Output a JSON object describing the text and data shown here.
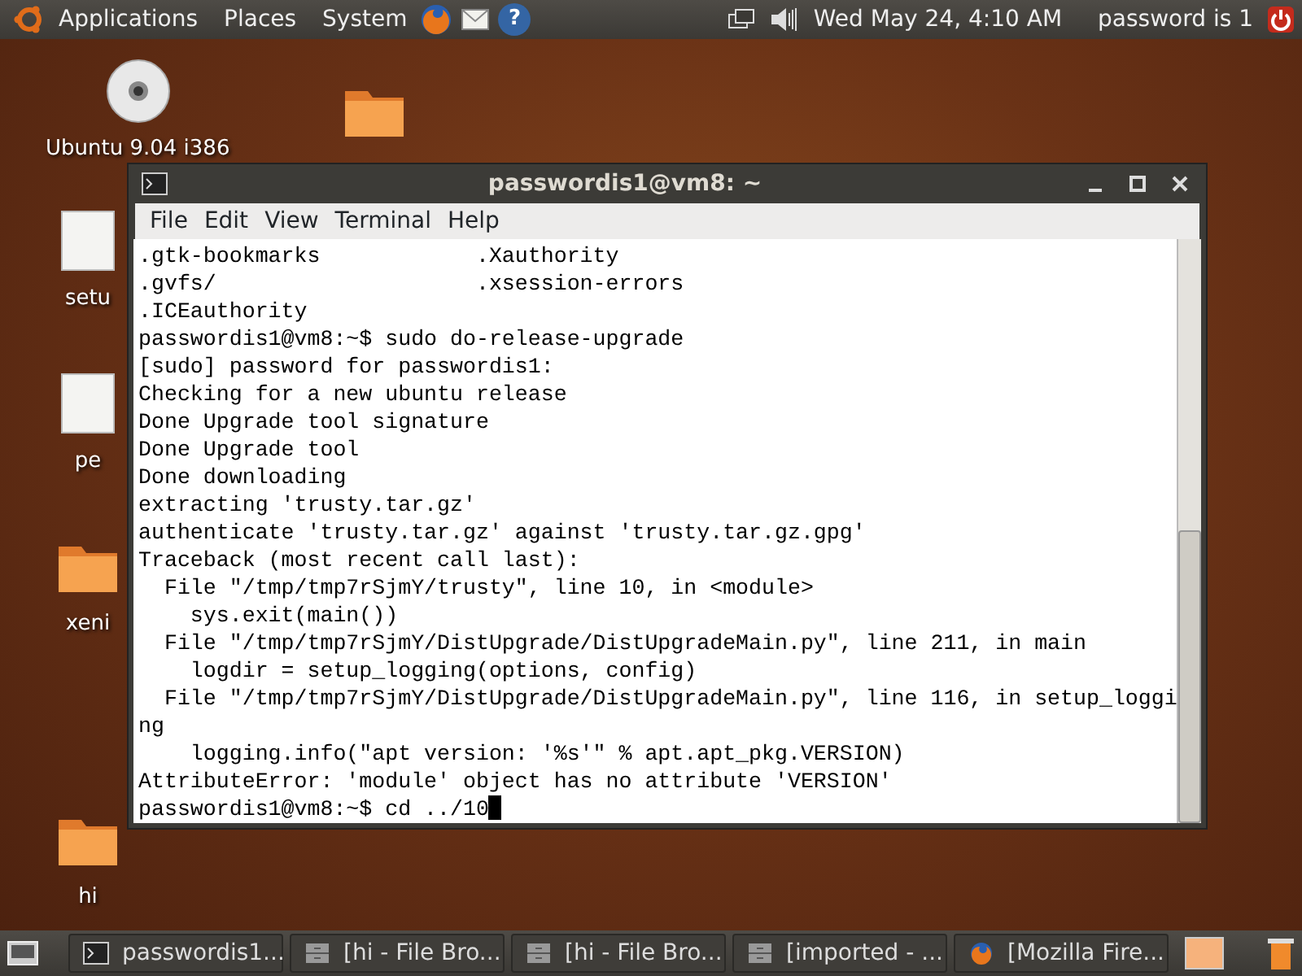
{
  "top_panel": {
    "menus": [
      "Applications",
      "Places",
      "System"
    ],
    "clock": "Wed May 24,  4:10 AM",
    "user": "password is 1",
    "help_glyph": "?"
  },
  "desktop_icons": [
    {
      "kind": "disc",
      "label": "Ubuntu 9.04 i386"
    },
    {
      "kind": "folder"
    },
    {
      "kind": "file",
      "label": "setu"
    },
    {
      "kind": "file",
      "label": "pe"
    },
    {
      "kind": "folder",
      "label": "xeni"
    },
    {
      "kind": "folder",
      "label": "hi"
    }
  ],
  "terminal": {
    "title": "passwordis1@vm8: ~",
    "menu": [
      "File",
      "Edit",
      "View",
      "Terminal",
      "Help"
    ],
    "lines": [
      ".gtk-bookmarks            .Xauthority",
      ".gvfs/                    .xsession-errors",
      ".ICEauthority",
      "passwordis1@vm8:~$ sudo do-release-upgrade",
      "[sudo] password for passwordis1:",
      "Checking for a new ubuntu release",
      "Done Upgrade tool signature",
      "Done Upgrade tool",
      "Done downloading",
      "extracting 'trusty.tar.gz'",
      "authenticate 'trusty.tar.gz' against 'trusty.tar.gz.gpg'",
      "Traceback (most recent call last):",
      "  File \"/tmp/tmp7rSjmY/trusty\", line 10, in <module>",
      "    sys.exit(main())",
      "  File \"/tmp/tmp7rSjmY/DistUpgrade/DistUpgradeMain.py\", line 211, in main",
      "    logdir = setup_logging(options, config)",
      "  File \"/tmp/tmp7rSjmY/DistUpgrade/DistUpgradeMain.py\", line 116, in setup_loggi",
      "ng",
      "    logging.info(\"apt version: '%s'\" % apt.apt_pkg.VERSION)",
      "AttributeError: 'module' object has no attribute 'VERSION'",
      "passwordis1@vm8:~$ cd ../10"
    ]
  },
  "taskbar": [
    {
      "kind": "terminal",
      "label": "passwordis1..."
    },
    {
      "kind": "cabinet",
      "label": "[hi - File Bro..."
    },
    {
      "kind": "cabinet",
      "label": "[hi - File Bro..."
    },
    {
      "kind": "cabinet",
      "label": "[imported - ..."
    },
    {
      "kind": "browser",
      "label": "[Mozilla Fire..."
    }
  ]
}
